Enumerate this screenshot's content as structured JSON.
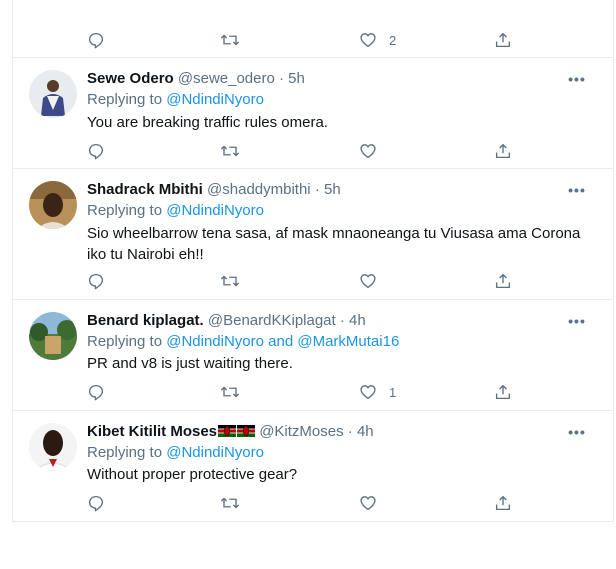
{
  "top_actions": {
    "like_count": "2"
  },
  "tweets": [
    {
      "name": "Sewe Odero",
      "handle": "@sewe_odero",
      "dot": "·",
      "time": "5h",
      "replying_prefix": "Replying to ",
      "mention1": "@NdindiNyoro",
      "text": "You are breaking traffic rules omera.",
      "like_count": ""
    },
    {
      "name": "Shadrack Mbithi",
      "handle": "@shaddymbithi",
      "dot": "·",
      "time": "5h",
      "replying_prefix": "Replying to ",
      "mention1": "@NdindiNyoro",
      "text": "Sio wheelbarrow tena sasa, af mask mnaoneanga tu Viusasa ama Corona iko tu Nairobi eh!!",
      "like_count": ""
    },
    {
      "name": "Benard kiplagat.",
      "handle": "@BenardKKiplagat",
      "dot": "·",
      "time": "4h",
      "replying_prefix": "Replying to ",
      "mention1": "@NdindiNyoro",
      "and": " and ",
      "mention2": "@MarkMutai16",
      "text": "PR and v8 is just waiting there.",
      "like_count": "1"
    },
    {
      "name": "Kibet Kitilit Moses",
      "handle": "@KitzMoses",
      "dot": "·",
      "time": "4h",
      "replying_prefix": "Replying to ",
      "mention1": "@NdindiNyoro",
      "text": "Without proper protective gear?",
      "like_count": ""
    }
  ],
  "more_glyph": "•••",
  "colors": {
    "secondary_text": "#5b7083",
    "link": "#1b95e0",
    "divider": "#e6ecf0"
  },
  "icons": {
    "reply": "reply-icon",
    "retweet": "retweet-icon",
    "like": "heart-icon",
    "share": "share-icon",
    "more": "more-options-icon",
    "flag": "kenya-flag-icon"
  }
}
